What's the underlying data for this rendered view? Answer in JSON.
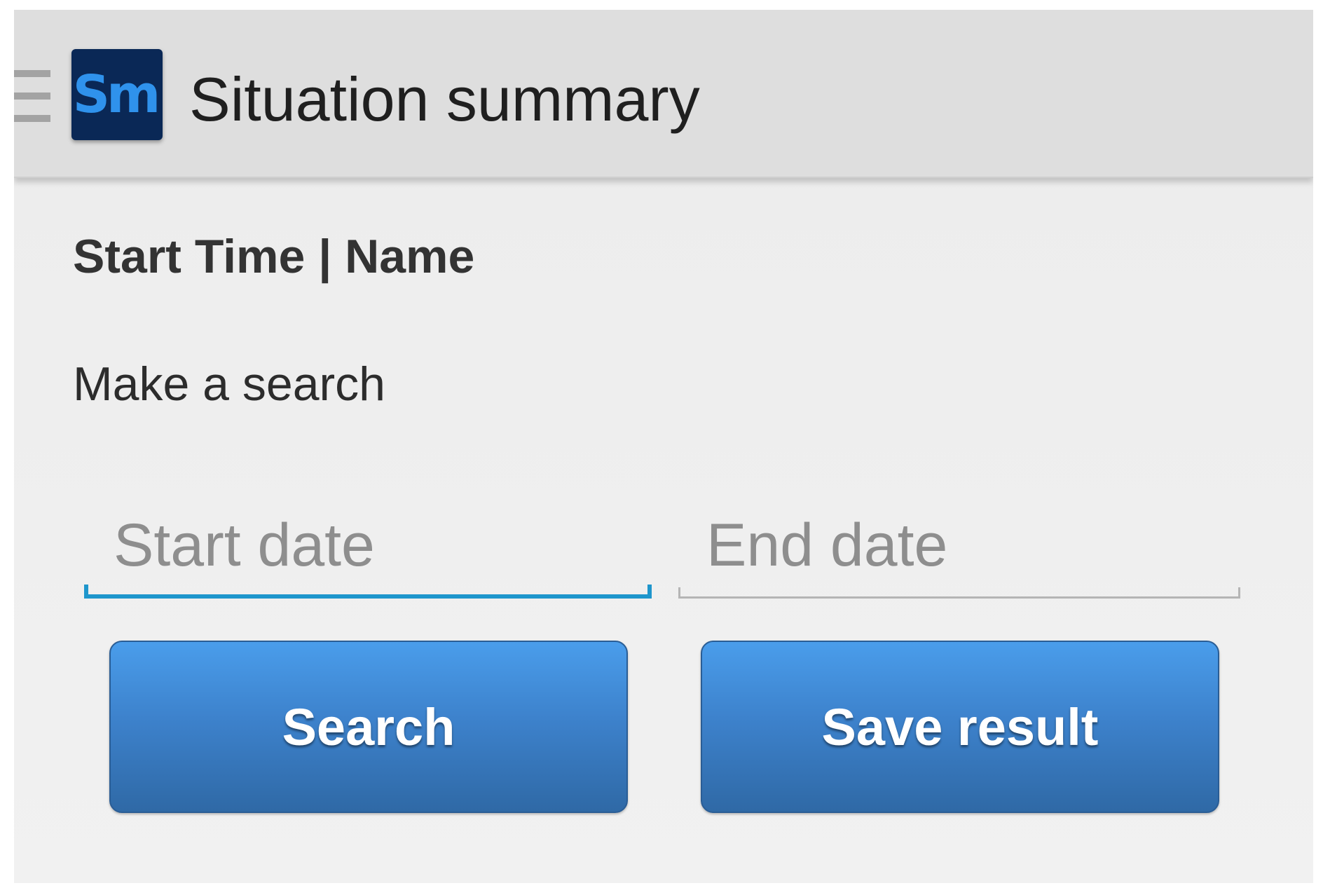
{
  "app_bar": {
    "menu_icon": "hamburger-menu-icon",
    "logo_text": "Sm",
    "title": "Situation summary"
  },
  "list": {
    "header": "Start Time | Name",
    "status": "Make a search"
  },
  "filters": {
    "start_date": {
      "value": "",
      "placeholder": "Start date",
      "focused": true
    },
    "end_date": {
      "value": "",
      "placeholder": "End date",
      "focused": false
    }
  },
  "actions": {
    "search_label": "Search",
    "save_label": "Save result"
  },
  "colors": {
    "app_bar": "#dedede",
    "logo_bg": "#0a2856",
    "logo_text": "#2f92ec",
    "focus_underline": "#1e96cc",
    "button_top": "#4a9deb",
    "button_bottom": "#2f69a6"
  }
}
